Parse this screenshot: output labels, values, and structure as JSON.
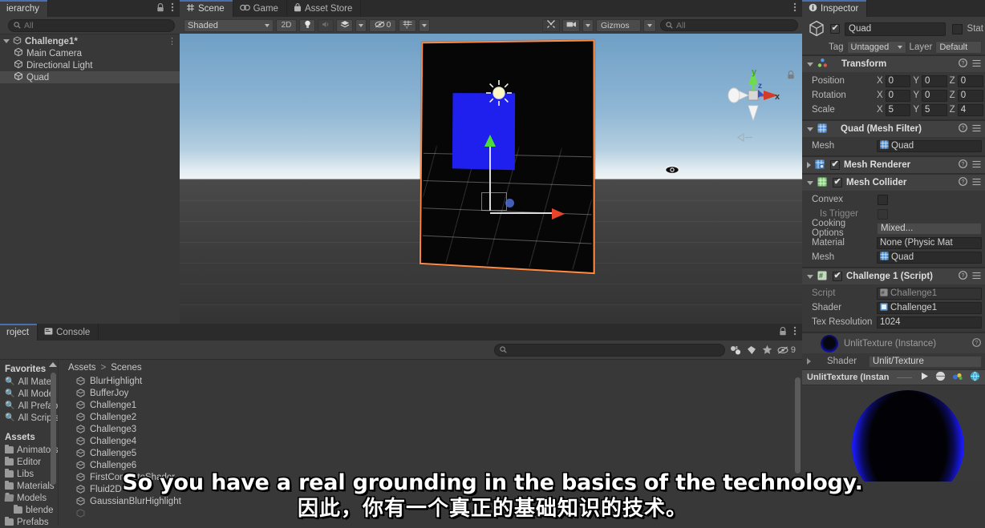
{
  "hierarchy": {
    "tab_label": "ierarchy",
    "lock_icon": "lock-icon",
    "menu_icon": "kebab-menu-icon",
    "search_placeholder": "All",
    "rows": [
      {
        "label": "Challenge1*",
        "icon": "scene-icon",
        "depth": 0,
        "selected": false,
        "expanded": true
      },
      {
        "label": "Main Camera",
        "icon": "gameobject-cube-icon",
        "depth": 1,
        "selected": false
      },
      {
        "label": "Directional Light",
        "icon": "gameobject-cube-icon",
        "depth": 1,
        "selected": false
      },
      {
        "label": "Quad",
        "icon": "gameobject-cube-icon",
        "depth": 1,
        "selected": true
      }
    ]
  },
  "scene": {
    "tabs": [
      {
        "label": "Scene",
        "icon": "scene-grid-icon",
        "active": true
      },
      {
        "label": "Game",
        "icon": "gamepad-icon",
        "active": false
      },
      {
        "label": "Asset Store",
        "icon": "store-bag-icon",
        "active": false
      }
    ],
    "menu_icon": "kebab-menu-icon",
    "toolbar": {
      "draw_mode": "Shaded",
      "two_d_label": "2D",
      "light_icon": "lightbulb-icon",
      "audio_icon": "audio-icon",
      "fx_icon": "effects-icon",
      "hidden_count": "0",
      "grid_icon": "grid-y-icon",
      "tools_icon": "tools-icon",
      "camera_icon": "scene-camera-icon",
      "gizmos_label": "Gizmos",
      "search_placeholder": "All"
    },
    "gizmo": {
      "axis_x": "x",
      "axis_y": "y",
      "axis_z": "z",
      "lock_icon": "gizmo-lock-icon",
      "persp_icon": "persp-icon"
    },
    "overlays": {
      "sun_icon": "directional-light-gizmo",
      "eye_icon": "visibility-eye-icon",
      "selection_outline_color": "#ff8a42",
      "quad_fill_color": "#1f1fee"
    }
  },
  "inspector": {
    "tab_label": "Inspector",
    "tab_icon": "info-circle-icon",
    "object": {
      "enabled": true,
      "name": "Quad",
      "static_label": "Stat",
      "tag_label": "Tag",
      "tag_value": "Untagged",
      "layer_label": "Layer",
      "layer_value": "Default"
    },
    "components": [
      {
        "title": "Transform",
        "icon": "transform-icon",
        "expanded": true,
        "has_checkbox": false,
        "rows": [
          {
            "name": "Position",
            "type": "vec3",
            "x": "0",
            "y": "0",
            "z": "0"
          },
          {
            "name": "Rotation",
            "type": "vec3",
            "x": "0",
            "y": "0",
            "z": "0"
          },
          {
            "name": "Scale",
            "type": "vec3",
            "x": "5",
            "y": "5",
            "z": "4"
          }
        ]
      },
      {
        "title": "Quad (Mesh Filter)",
        "icon": "mesh-filter-icon",
        "expanded": true,
        "has_checkbox": false,
        "rows": [
          {
            "name": "Mesh",
            "type": "object",
            "value": "Quad",
            "value_icon": "mesh-icon"
          }
        ]
      },
      {
        "title": "Mesh Renderer",
        "icon": "mesh-renderer-icon",
        "expanded": false,
        "has_checkbox": true,
        "checked": true,
        "rows": []
      },
      {
        "title": "Mesh Collider",
        "icon": "mesh-collider-icon",
        "expanded": true,
        "has_checkbox": true,
        "checked": true,
        "rows": [
          {
            "name": "Convex",
            "type": "checkbox",
            "checked": false
          },
          {
            "name": "Is Trigger",
            "type": "checkbox",
            "checked": false,
            "dim": true
          },
          {
            "name": "Cooking Options",
            "type": "grey",
            "value": "Mixed..."
          },
          {
            "name": "Material",
            "type": "object",
            "value": "None (Physic Mat"
          },
          {
            "name": "Mesh",
            "type": "object",
            "value": "Quad",
            "value_icon": "mesh-icon"
          }
        ]
      },
      {
        "title": "Challenge 1 (Script)",
        "icon": "script-icon",
        "expanded": true,
        "has_checkbox": true,
        "checked": true,
        "rows": [
          {
            "name": "Script",
            "type": "object",
            "value": "Challenge1",
            "dim": true,
            "value_icon": "script-icon"
          },
          {
            "name": "Shader",
            "type": "object",
            "value": "Challenge1",
            "value_icon": "shader-icon"
          },
          {
            "name": "Tex Resolution",
            "type": "text",
            "value": "1024"
          }
        ]
      }
    ],
    "material": {
      "title": "UnlitTexture (Instance)",
      "shader_label": "Shader",
      "shader_value": "Unlit/Texture",
      "help_icon": "help-circle-icon",
      "preview_label": "UnlitTexture (Instan",
      "play_icon": "play-icon",
      "sphere_icon": "preview-sphere-icon",
      "lighting_icon": "preview-lighting-icon",
      "globe_icon": "preview-globe-icon"
    }
  },
  "project": {
    "tabs": [
      {
        "label": "roject",
        "icon": "project-folder-icon",
        "active": true
      },
      {
        "label": "Console",
        "icon": "console-icon",
        "active": false
      }
    ],
    "lock_icon": "lock-icon",
    "menu_icon": "kebab-menu-icon",
    "search_placeholder": "",
    "toolbar_icons": [
      "asset-filter-icon",
      "label-filter-icon",
      "favorite-star-icon",
      "hidden-eye-icon"
    ],
    "hidden_count": "9",
    "favorites": {
      "header": "Favorites",
      "items": [
        "All Materi",
        "All Model",
        "All Prefab",
        "All Scripts"
      ]
    },
    "assets": {
      "header": "Assets",
      "items": [
        {
          "label": "Animators",
          "indent": 0,
          "open": false
        },
        {
          "label": "Editor",
          "indent": 0,
          "open": false
        },
        {
          "label": "Libs",
          "indent": 0,
          "open": false
        },
        {
          "label": "Materials",
          "indent": 0,
          "open": false
        },
        {
          "label": "Models",
          "indent": 0,
          "open": true
        },
        {
          "label": "blende",
          "indent": 1,
          "open": false
        },
        {
          "label": "Prefabs",
          "indent": 0,
          "open": false
        }
      ]
    },
    "breadcrumb": [
      "Assets",
      "Scenes"
    ],
    "files": [
      "BlurHighlight",
      "BufferJoy",
      "Challenge1",
      "Challenge2",
      "Challenge3",
      "Challenge4",
      "Challenge5",
      "Challenge6",
      "FirstComputeShader",
      "Fluid2D",
      "GaussianBlurHighlight"
    ]
  },
  "subtitles": {
    "english": "So you have a real grounding in the basics of the technology.",
    "chinese": "因此，你有一个真正的基础知识的技术。"
  }
}
